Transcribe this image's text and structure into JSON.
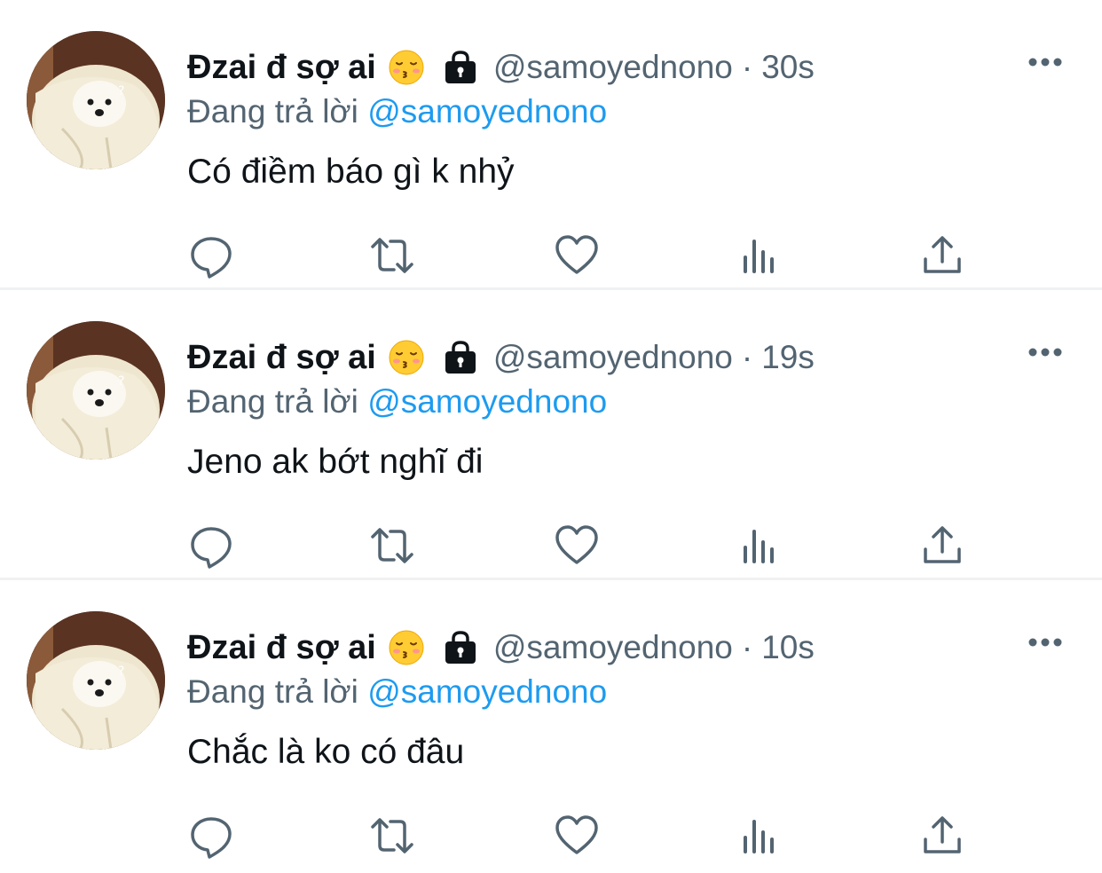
{
  "tweets": [
    {
      "display_name": "Đzai đ sợ ai",
      "handle": "@samoyednono",
      "separator": "·",
      "time": "30s",
      "replying_prefix": "Đang trả lời",
      "replying_to": "@samoyednono",
      "text": "Có điềm báo gì k nhỷ"
    },
    {
      "display_name": "Đzai đ sợ ai",
      "handle": "@samoyednono",
      "separator": "·",
      "time": "19s",
      "replying_prefix": "Đang trả lời",
      "replying_to": "@samoyednono",
      "text": "Jeno ak bớt nghĩ đi"
    },
    {
      "display_name": "Đzai đ sợ ai",
      "handle": "@samoyednono",
      "separator": "·",
      "time": "10s",
      "replying_prefix": "Đang trả lời",
      "replying_to": "@samoyednono",
      "text": "Chắc là ko có đâu"
    }
  ],
  "icons": {
    "emoji": "kissing-face-closed-eyes-emoji",
    "lock": "lock-icon",
    "more": "more-icon",
    "actions": [
      "reply-icon",
      "retweet-icon",
      "like-icon",
      "views-icon",
      "share-icon"
    ]
  },
  "colors": {
    "text": "#0f1419",
    "secondary": "#536471",
    "accent": "#1d9bf0",
    "divider": "#eff1f3"
  }
}
